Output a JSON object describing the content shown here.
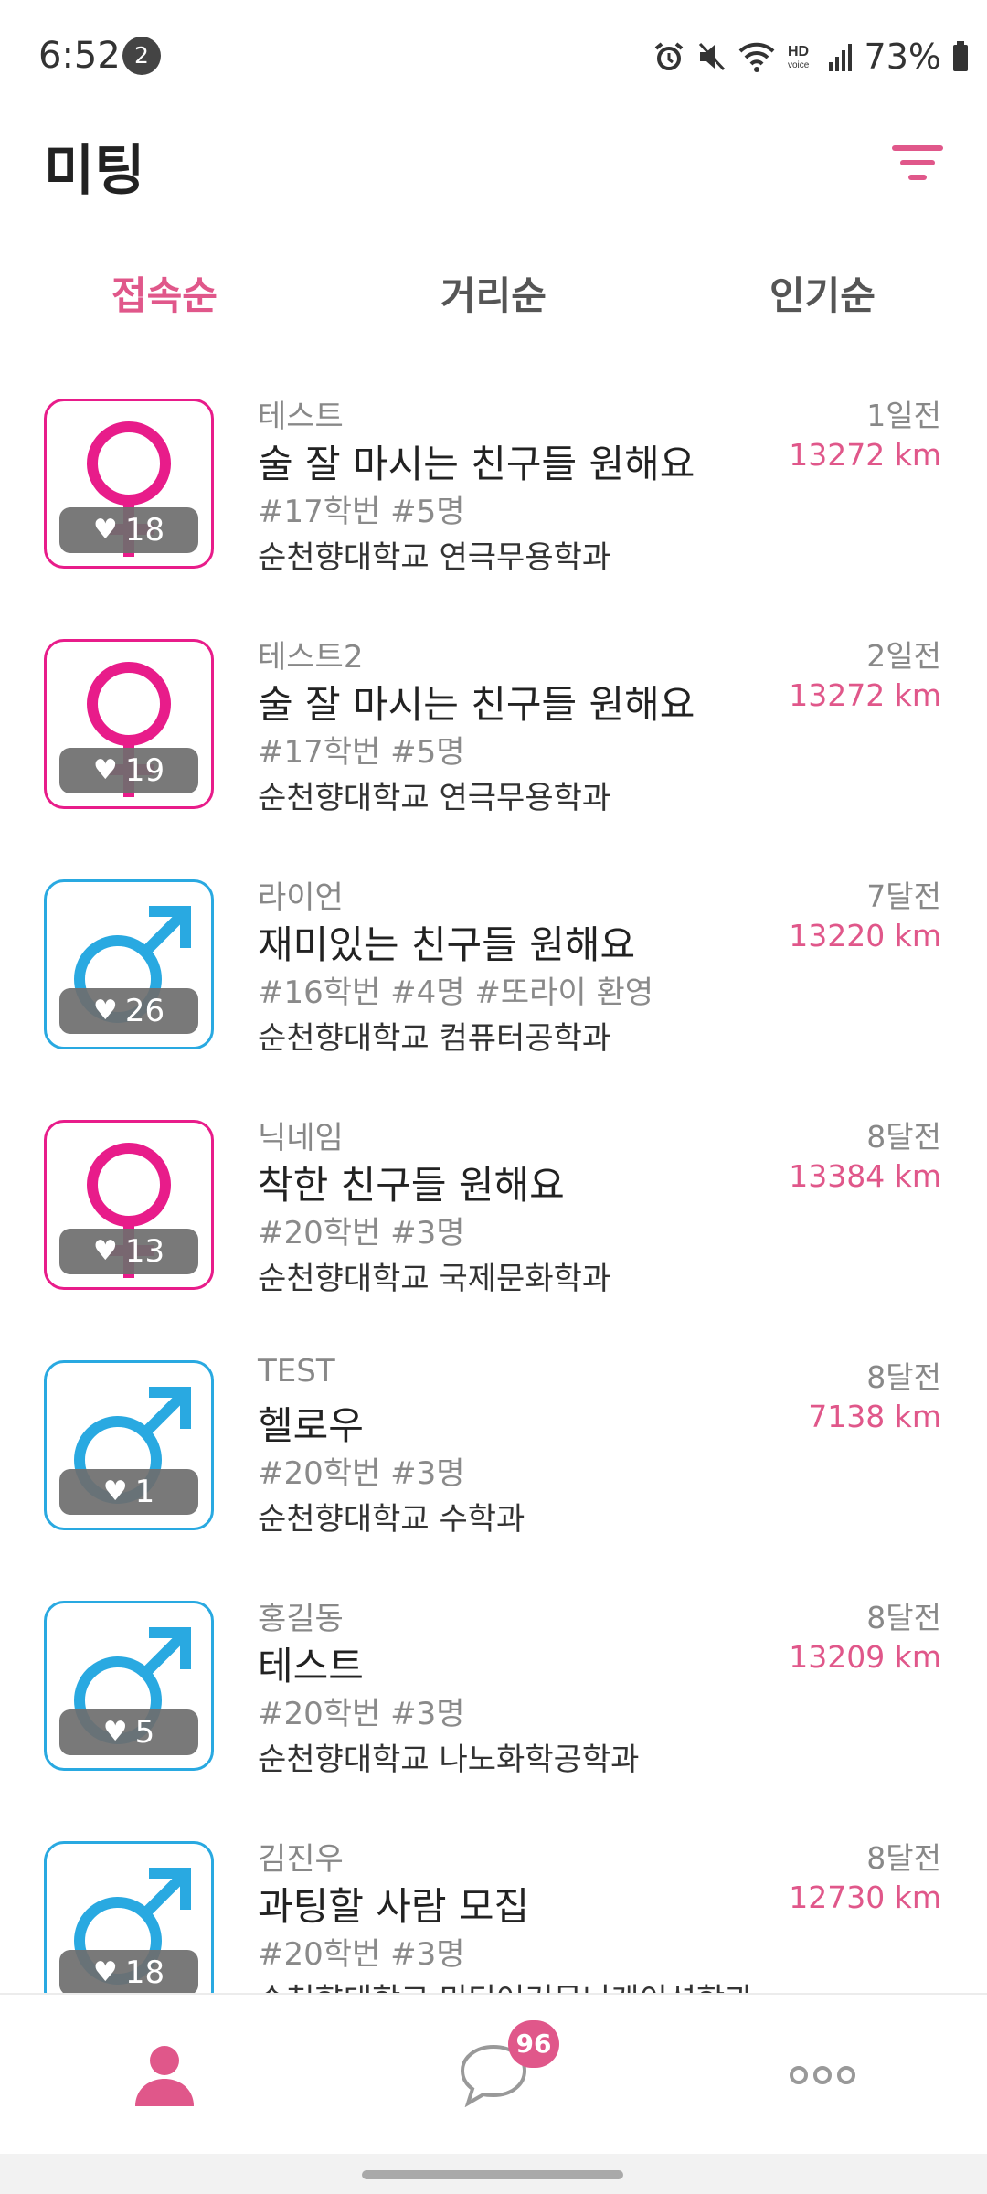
{
  "status_bar": {
    "time": "6:52",
    "notification_count": "2",
    "battery": "73%",
    "icons": [
      "alarm-icon",
      "mute-icon",
      "wifi-icon",
      "hd-voice-icon",
      "signal-icon",
      "battery-icon"
    ]
  },
  "header": {
    "title": "미팅",
    "filter_icon": "filter-icon"
  },
  "tabs": [
    {
      "label": "접속순",
      "active": true
    },
    {
      "label": "거리순",
      "active": false
    },
    {
      "label": "인기순",
      "active": false
    }
  ],
  "items": [
    {
      "gender": "female",
      "likes": "18",
      "nickname": "테스트",
      "title": "술 잘 마시는 친구들 원해요",
      "tags": "#17학번 #5명",
      "school": "순천향대학교 연극무용학과",
      "time": "1일전",
      "distance": "13272 km"
    },
    {
      "gender": "female",
      "likes": "19",
      "nickname": "테스트2",
      "title": "술 잘 마시는 친구들 원해요",
      "tags": "#17학번 #5명",
      "school": "순천향대학교 연극무용학과",
      "time": "2일전",
      "distance": "13272 km"
    },
    {
      "gender": "male",
      "likes": "26",
      "nickname": "라이언",
      "title": "재미있는 친구들 원해요",
      "tags": "#16학번 #4명 #또라이 환영",
      "school": "순천향대학교 컴퓨터공학과",
      "time": "7달전",
      "distance": "13220 km"
    },
    {
      "gender": "female",
      "likes": "13",
      "nickname": "닉네임",
      "title": "착한 친구들 원해요",
      "tags": "#20학번 #3명",
      "school": "순천향대학교 국제문화학과",
      "time": "8달전",
      "distance": "13384 km"
    },
    {
      "gender": "male",
      "likes": "1",
      "nickname": "TEST",
      "title": "헬로우",
      "tags": "#20학번 #3명",
      "school": "순천향대학교 수학과",
      "time": "8달전",
      "distance": "7138 km"
    },
    {
      "gender": "male",
      "likes": "5",
      "nickname": "홍길동",
      "title": "테스트",
      "tags": "#20학번 #3명",
      "school": "순천향대학교 나노화학공학과",
      "time": "8달전",
      "distance": "13209 km"
    },
    {
      "gender": "male",
      "likes": "18",
      "nickname": "김진우",
      "title": "과팅할 사람 모집",
      "tags": "#20학번 #3명",
      "school": "순천향대학교 미디어커뮤니케이션학과",
      "time": "8달전",
      "distance": "12730 km"
    }
  ],
  "bottom_nav": {
    "profile_icon": "person-icon",
    "chat_icon": "chat-bubble-icon",
    "chat_badge": "96",
    "more_icon": "more-dots-icon",
    "accent_color": "#e0578a"
  },
  "colors": {
    "accent": "#e0578a",
    "female": "#e81c8a",
    "male": "#29a9e1"
  }
}
